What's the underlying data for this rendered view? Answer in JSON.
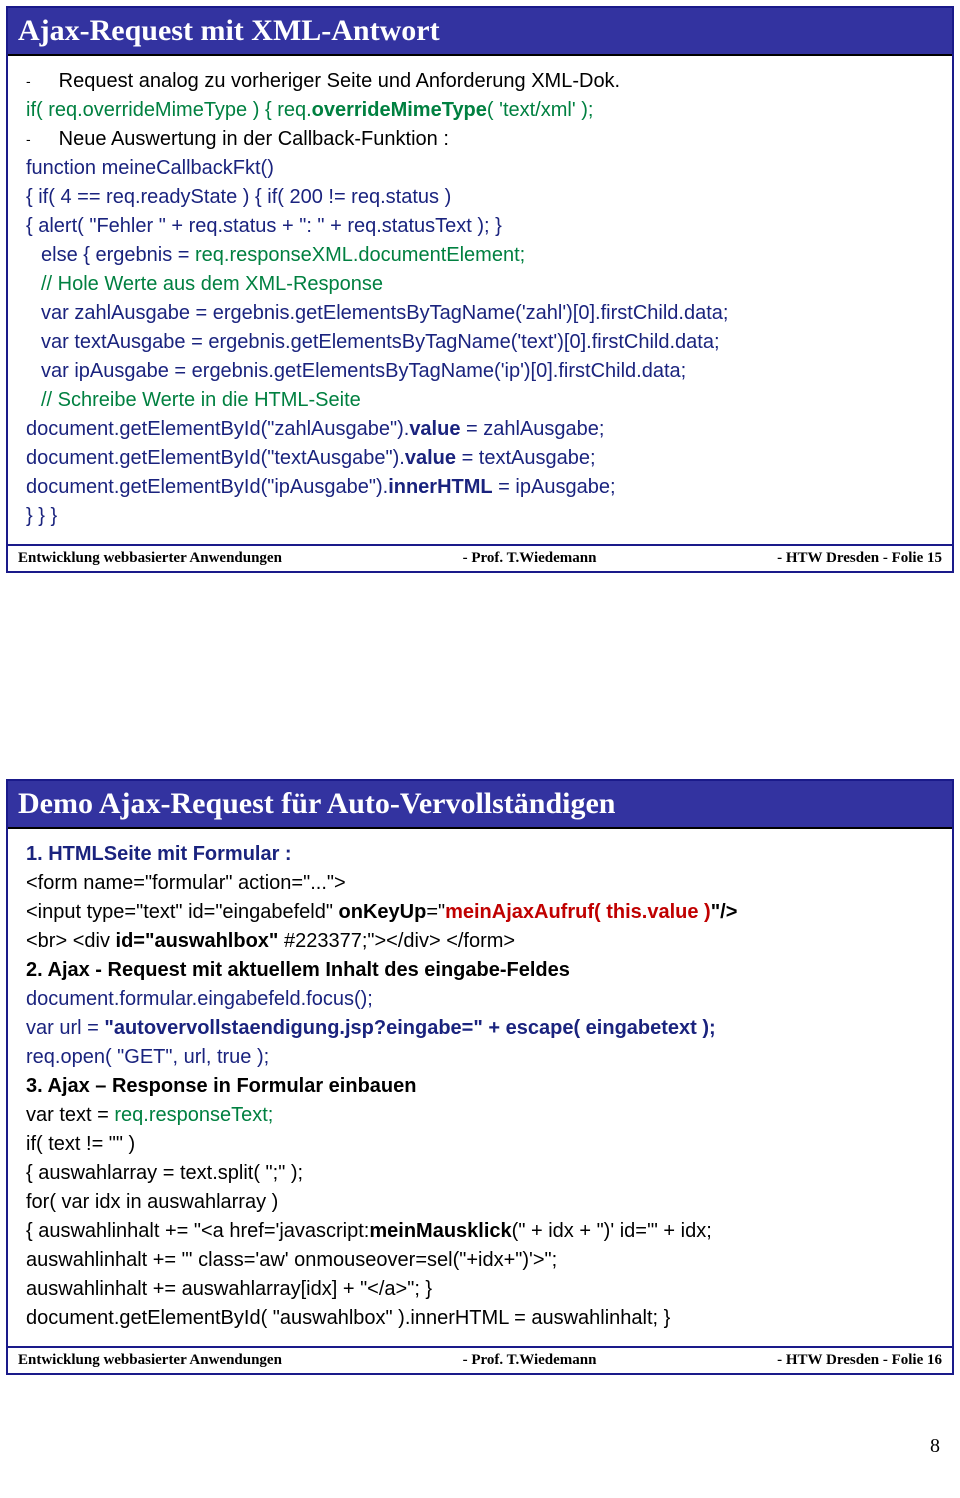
{
  "slide1": {
    "title": "Ajax-Request  mit XML-Antwort",
    "l1": "Request analog zu  vorheriger Seite und Anforderung XML-Dok.",
    "l2a": "if( req.overrideMimeType ) { req.",
    "l2b": "overrideMimeType",
    "l2c": "( 'text/xml' );",
    "l3": "Neue Auswertung in der Callback-Funktion :",
    "l4": "function meineCallbackFkt()",
    "l5": "{  if( 4 == req.readyState ) { if( 200 != req.status )",
    "l6": "{ alert( \"Fehler \" + req.status + \": \" + req.statusText ); }",
    "l7a": "else { ergebnis = ",
    "l7b": "req.responseXML.documentElement;",
    "l8": "// Hole  Werte aus dem XML-Response",
    "l9": "var zahlAusgabe = ergebnis.getElementsByTagName('zahl')[0].firstChild.data;",
    "l10": "var textAusgabe = ergebnis.getElementsByTagName('text')[0].firstChild.data;",
    "l11": "var ipAusgabe = ergebnis.getElementsByTagName('ip')[0].firstChild.data;",
    "l12": "// Schreibe Werte  in die HTML-Seite",
    "l13a": "document.getElementById(\"zahlAusgabe\").",
    "l13b": "value",
    "l13c": " = zahlAusgabe;",
    "l14a": "document.getElementById(\"textAusgabe\").",
    "l14b": "value",
    "l14c": " = textAusgabe;",
    "l15a": "document.getElementById(\"ipAusgabe\").",
    "l15b": "innerHTML",
    "l15c": " = ipAusgabe;",
    "l16": "} } }",
    "footer_left": "Entwicklung webbasierter Anwendungen",
    "footer_mid": "-    Prof. T.Wiedemann",
    "footer_right": "-   HTW Dresden -     Folie 15"
  },
  "slide2": {
    "title": "Demo Ajax-Request  für Auto-Vervollständigen",
    "h1": "1.  HTMLSeite mit Formular :",
    "l1": "<form name=\"formular\" action=\"...\">",
    "l2a": "<input type=\"text\" id=\"eingabefeld\" ",
    "l2b": "onKeyUp",
    "l2c": "=\"",
    "l2d": "meinAjaxAufruf( this.value )",
    "l2e": "\"/>",
    "l3a": "<br> <div ",
    "l3b": "id=\"auswahlbox\"",
    "l3c": " #223377;\"></div> </form>",
    "h2": "2.  Ajax - Request mit aktuellem Inhalt des eingabe-Feldes",
    "l4": "document.formular.eingabefeld.focus();",
    "l5a": "var url = ",
    "l5b": "\"autovervollstaendigung.jsp?eingabe=\" + escape( eingabetext );",
    "l6": "req.open( \"GET\", url, true );",
    "h3": "3.  Ajax – Response in Formular einbauen",
    "l7a": "var text = ",
    "l7b": "req.responseText;",
    "l8": "if( text != \"\" )",
    "l9": "{ auswahlarray = text.split( \";\" );",
    "l10": "for( var idx in auswahlarray )",
    "l11a": "{ auswahlinhalt += \"<a href='javascript:",
    "l11b": "meinMausklick",
    "l11c": "(\" + idx + \")' id='\" + idx;",
    "l12": "auswahlinhalt += \"' class='aw' onmouseover=sel(\"+idx+\")'>\";",
    "l13": "auswahlinhalt += auswahlarray[idx] + \"</a>\"; }",
    "l14": "document.getElementById( \"auswahlbox\" ).innerHTML = auswahlinhalt; }",
    "footer_left": "Entwicklung webbasierter Anwendungen",
    "footer_mid": "-    Prof. T.Wiedemann",
    "footer_right": "-   HTW Dresden -     Folie 16"
  },
  "page_number": "8"
}
